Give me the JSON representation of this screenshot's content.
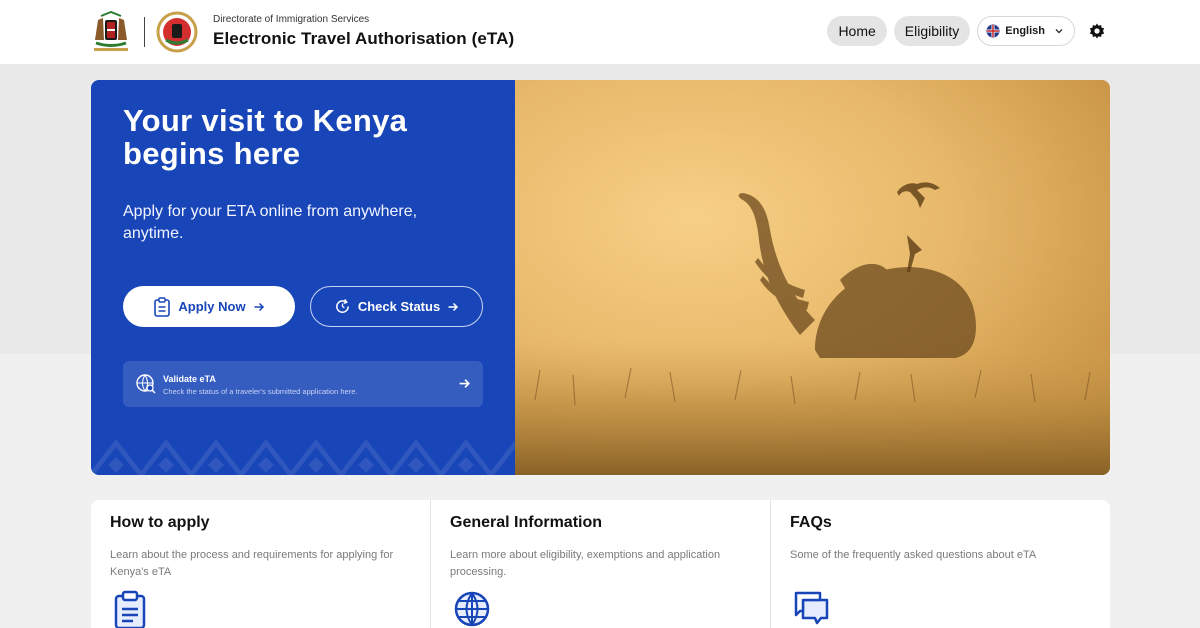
{
  "header": {
    "subtitle": "Directorate of Immigration Services",
    "title": "Electronic Travel Authorisation (eTA)",
    "nav": {
      "home": "Home",
      "eligibility": "Eligibility",
      "language": "English"
    }
  },
  "hero": {
    "title_line1": "Your visit to Kenya",
    "title_line2": "begins here",
    "text": "Apply for your ETA online from anywhere, anytime.",
    "apply_label": "Apply Now",
    "check_label": "Check Status",
    "validate_title": "Validate eTA",
    "validate_desc": "Check the status of a traveler's submitted application here."
  },
  "cards": [
    {
      "title": "How to apply",
      "desc": "Learn about the process and requirements for applying for Kenya's eTA",
      "icon": "clipboard-icon"
    },
    {
      "title": "General Information",
      "desc": "Learn more about eligibility, exemptions and application processing.",
      "icon": "globe-icon"
    },
    {
      "title": "FAQs",
      "desc": "Some of the frequently asked questions about eTA",
      "icon": "chat-icon"
    }
  ],
  "colors": {
    "primary": "#1845b7",
    "hero_photo": "#e2ae5c"
  }
}
